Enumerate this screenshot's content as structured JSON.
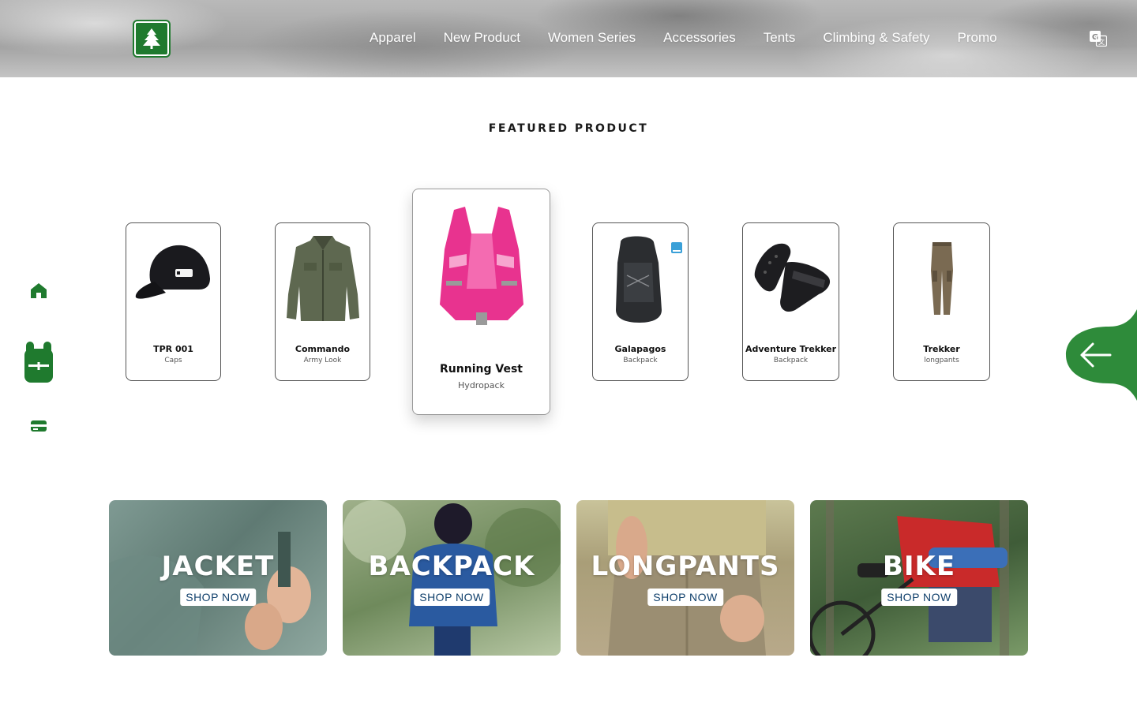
{
  "header": {
    "logo_icon": "pine-tree-icon",
    "nav": [
      "Apparel",
      "New Product",
      "Women Series",
      "Accessories",
      "Tents",
      "Climbing & Safety",
      "Promo"
    ],
    "translate_icon": "translate-icon"
  },
  "featured": {
    "title": "FEATURED PRODUCT",
    "products": [
      {
        "name": "TPR 001",
        "category": "Caps",
        "icon": "cap-image"
      },
      {
        "name": "Commando",
        "category": "Army Look",
        "icon": "jacket-image"
      },
      {
        "name": "Running Vest",
        "category": "Hydropack",
        "icon": "vest-image",
        "active": true
      },
      {
        "name": "Galapagos",
        "category": "Backpack",
        "icon": "backpack-image"
      },
      {
        "name": "Adventure Trekker",
        "category": "Backpack",
        "icon": "sandal-image"
      },
      {
        "name": "Trekker",
        "category": "longpants",
        "icon": "pants-image"
      }
    ]
  },
  "side_nav": [
    "home-icon",
    "backpack-icon",
    "card-icon"
  ],
  "back_button_icon": "arrow-left-icon",
  "categories": [
    {
      "title": "JACKET",
      "cta": "SHOP NOW"
    },
    {
      "title": "BACKPACK",
      "cta": "SHOP NOW"
    },
    {
      "title": "LONGPANTS",
      "cta": "SHOP NOW"
    },
    {
      "title": "BIKE",
      "cta": "SHOP NOW"
    }
  ],
  "colors": {
    "brand_green": "#1f7a2e",
    "nav_text": "#ffffff",
    "shop_text": "#0f3f6b"
  }
}
